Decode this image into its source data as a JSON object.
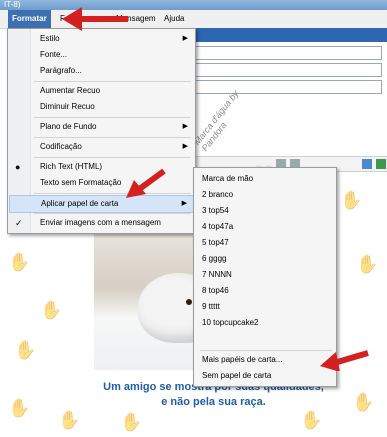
{
  "window": {
    "title_fragment": "IT-8)"
  },
  "menubar": {
    "items": [
      {
        "label": "Formatar",
        "active": true
      },
      {
        "label": "F",
        "active": false
      },
      {
        "label": "Mensagem",
        "active": false
      },
      {
        "label": "Ajuda",
        "active": false
      }
    ]
  },
  "format_menu": {
    "items": [
      {
        "label": "Estilo",
        "submenu": true
      },
      {
        "label": "Fonte...",
        "submenu": false
      },
      {
        "label": "Parágrafo...",
        "submenu": false
      },
      {
        "label": "Aumentar Recuo",
        "submenu": false
      },
      {
        "label": "Diminuir Recuo",
        "submenu": false
      },
      {
        "label": "Plano de Fundo",
        "submenu": true
      },
      {
        "label": "Codificação",
        "submenu": true
      },
      {
        "label": "Rich Text (HTML)",
        "mark": "●"
      },
      {
        "label": "Texto sem Formatação"
      },
      {
        "label": "Aplicar papel de carta",
        "submenu": true,
        "highlighted": true
      },
      {
        "label": "Enviar imagens com a mensagem",
        "mark": "✓"
      }
    ]
  },
  "stationery_submenu": {
    "items": [
      "Marca de mão",
      "2 branco",
      "3 top54",
      "4 top47a",
      "5 top47",
      "6 gggg",
      "7 NNNN",
      "8 top46",
      "9 ttttt",
      "10 topcupcake2"
    ],
    "more_label": "Mais papéis de carta...",
    "none_label": "Sem papel de carta"
  },
  "content": {
    "quote_line1": "Um amigo se mostra por suas qualidades,",
    "quote_line2": "e não pela sua raça.",
    "watermark": "Marca d'água by Pandora"
  },
  "colors": {
    "menu_active": "#3d6fb3",
    "quote": "#1d5fa8",
    "arrow": "#d32020",
    "highlight": "#d5e5f7"
  }
}
